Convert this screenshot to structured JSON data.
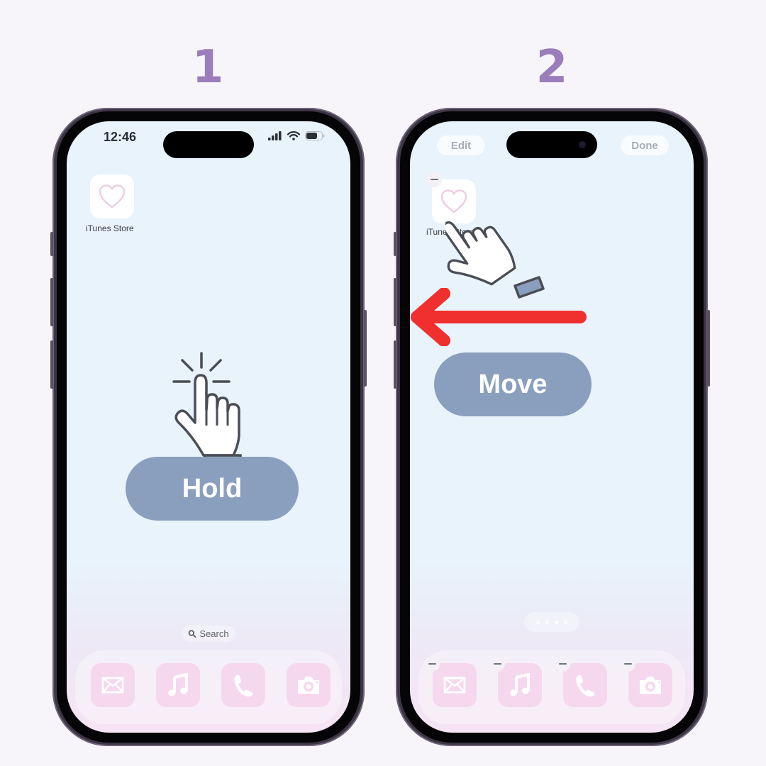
{
  "steps": [
    {
      "number": "1",
      "status_bar": {
        "time": "12:46"
      },
      "home": {
        "app": {
          "name": "iTunes Store",
          "icon": "heart-icon"
        },
        "search_label": "Search"
      },
      "action_label": "Hold",
      "gesture": "tap-hand-icon",
      "dock": [
        "mail-icon",
        "music-note-icon",
        "phone-icon",
        "camera-icon"
      ]
    },
    {
      "number": "2",
      "edit_mode": {
        "edit_label": "Edit",
        "done_label": "Done"
      },
      "home": {
        "app": {
          "name": "iTunes Store",
          "icon": "heart-icon"
        },
        "page_dots": 4,
        "active_page": 3
      },
      "action_label": "Move",
      "gesture": "drag-hand-icon",
      "direction": "left",
      "dock": [
        "mail-icon",
        "music-note-icon",
        "phone-icon",
        "camera-icon"
      ]
    }
  ],
  "colors": {
    "step_number": "#9b7dbb",
    "pill": "#8a9fbe",
    "arrow": "#f0302e",
    "dock_icon": "#f6d8ee"
  }
}
